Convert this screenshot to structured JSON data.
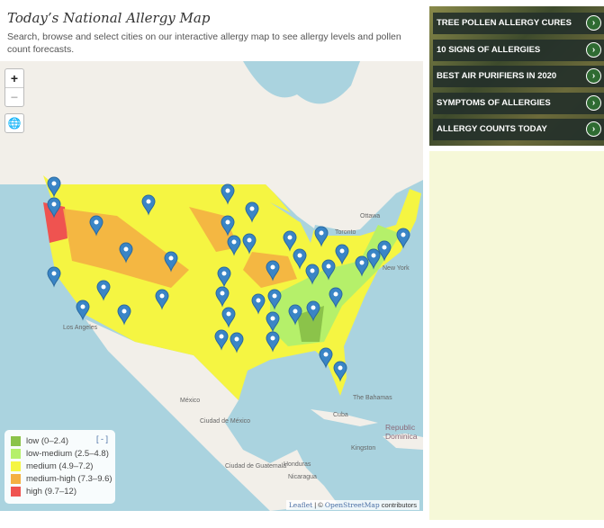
{
  "header": {
    "title": "Today’s National Allergy Map",
    "description": "Search, browse and select cities on our interactive allergy map to see allergy levels and pollen count forecasts."
  },
  "map": {
    "zoom_in": "+",
    "zoom_out": "−",
    "locate_icon": "globe-icon",
    "place_labels": [
      "Ottawa",
      "Toronto",
      "New York",
      "Los Angeles",
      "México",
      "Ciudad de México",
      "Cuba",
      "The Bahamas",
      "Kingston",
      "Ciudad de Guatemala",
      "Honduras",
      "Nicaragua",
      "Republic Dominica"
    ],
    "legend": {
      "collapse": "[ - ]",
      "items": [
        {
          "label": "low (0–2.4)",
          "color": "#8bc34a"
        },
        {
          "label": "low-medium (2.5–4.8)",
          "color": "#b5f06a"
        },
        {
          "label": "medium (4.9–7.2)",
          "color": "#f5f542"
        },
        {
          "label": "medium-high (7.3–9.6)",
          "color": "#f4b042"
        },
        {
          "label": "high (9.7–12)",
          "color": "#ef5350"
        }
      ]
    },
    "attribution": {
      "leaflet": "Leaflet",
      "sep": " | © ",
      "osm": "OpenStreetMap",
      "suffix": " contributors"
    }
  },
  "sidebar": {
    "links": [
      "TREE POLLEN ALLERGY CURES",
      "10 SIGNS OF ALLERGIES",
      "BEST AIR PURIFIERS IN 2020",
      "SYMPTOMS OF ALLERGIES",
      "ALLERGY COUNTS TODAY"
    ],
    "arrow": "›"
  }
}
